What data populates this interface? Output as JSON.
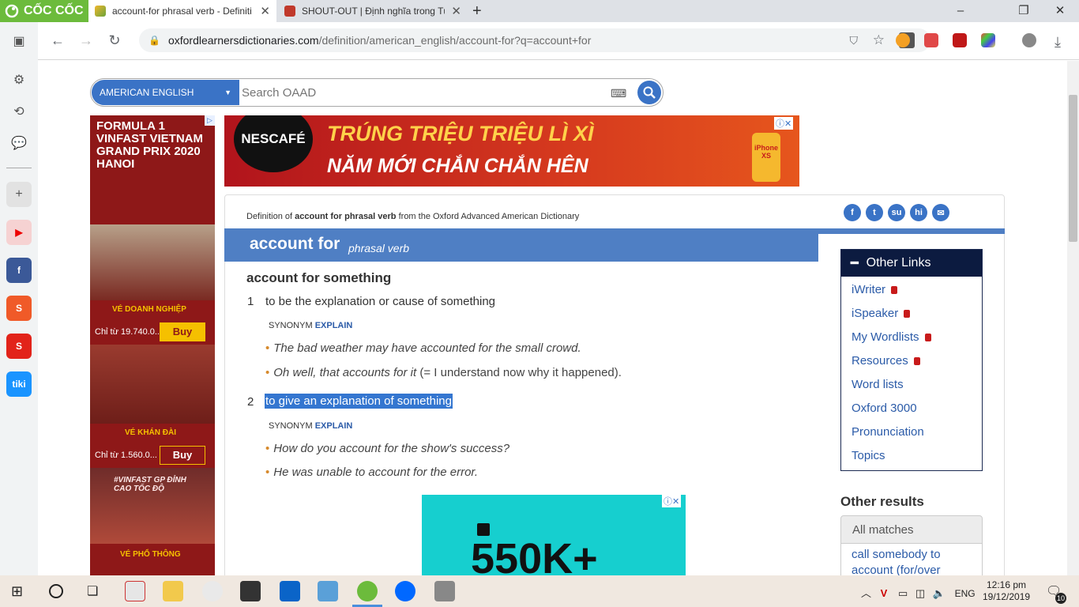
{
  "browser": {
    "brand": "CỐC CỐC",
    "tabs": [
      {
        "title": "account-for phrasal verb - Definiti",
        "active": true
      },
      {
        "title": "SHOUT-OUT | Định nghĩa trong Tủ",
        "active": false
      }
    ],
    "url_host": "oxfordlearnersdictionaries.com",
    "url_path": "/definition/american_english/account-for?q=account+for"
  },
  "search": {
    "dictionary": "AMERICAN ENGLISH",
    "placeholder": "Search OAAD"
  },
  "ads": {
    "top_brand": "NESCAFÉ",
    "top_line1": "TRÚNG TRIỆU TRIỆU LÌ XÌ",
    "top_line2": "NĂM MỚI CHẮN CHẮN HÊN",
    "top_phone": "iPhone XS",
    "left_f1": "FORMULA 1 VINFAST VIETNAM GRAND PRIX 2020 HANOI",
    "left_t1": "VÉ DOANH NGHIỆP",
    "left_p1": "Chỉ từ 19.740.0...",
    "left_b1": "Buy",
    "left_t2": "VÉ KHÁN ĐÀI",
    "left_p2": "Chỉ từ 1.560.0...",
    "left_b2": "Buy",
    "left_t3": "#VINFAST GP ĐỈNH CAO TỐC ĐỘ",
    "left_t4": "VÉ PHỔ THÔNG",
    "bottom_text": "550K+"
  },
  "entry": {
    "definition_of_prefix": "Definition of",
    "definition_of_term": "account for phrasal verb",
    "definition_of_suffix": "from the Oxford Advanced American Dictionary",
    "headword": "account for",
    "pos": "phrasal verb",
    "idiom": "account for something",
    "senses": [
      {
        "num": "1",
        "def": "to be the explanation or cause of something",
        "synonym_label": "SYNONYM",
        "synonym": "EXPLAIN",
        "examples": [
          {
            "text": "The bad weather may have accounted for the small crowd.",
            "gloss": ""
          },
          {
            "text": "Oh well, that accounts for it",
            "gloss": " (= I understand now why it happened)."
          }
        ]
      },
      {
        "num": "2",
        "def": "to give an explanation of something",
        "synonym_label": "SYNONYM",
        "synonym": "EXPLAIN",
        "examples": [
          {
            "text": "How do you account for the show's success?"
          },
          {
            "text": "He was unable to account for the error."
          }
        ]
      }
    ]
  },
  "other_links": {
    "title": "Other Links",
    "items": [
      "iWriter",
      "iSpeaker",
      "My Wordlists",
      "Resources",
      "Word lists",
      "Oxford 3000",
      "Pronunciation",
      "Topics"
    ],
    "locked": [
      true,
      true,
      true,
      true,
      false,
      false,
      false,
      false
    ]
  },
  "other_results": {
    "title": "Other results",
    "tab": "All matches",
    "items": [
      "call somebody to account (for/over"
    ]
  },
  "taskbar": {
    "language": "ENG",
    "time": "12:16 pm",
    "date": "19/12/2019",
    "notifications": "10"
  },
  "colors": {
    "oxford_blue": "#4f7fc4",
    "link": "#2b5ba8",
    "highlight": "#3476d0",
    "example_dot": "#d6892b"
  }
}
